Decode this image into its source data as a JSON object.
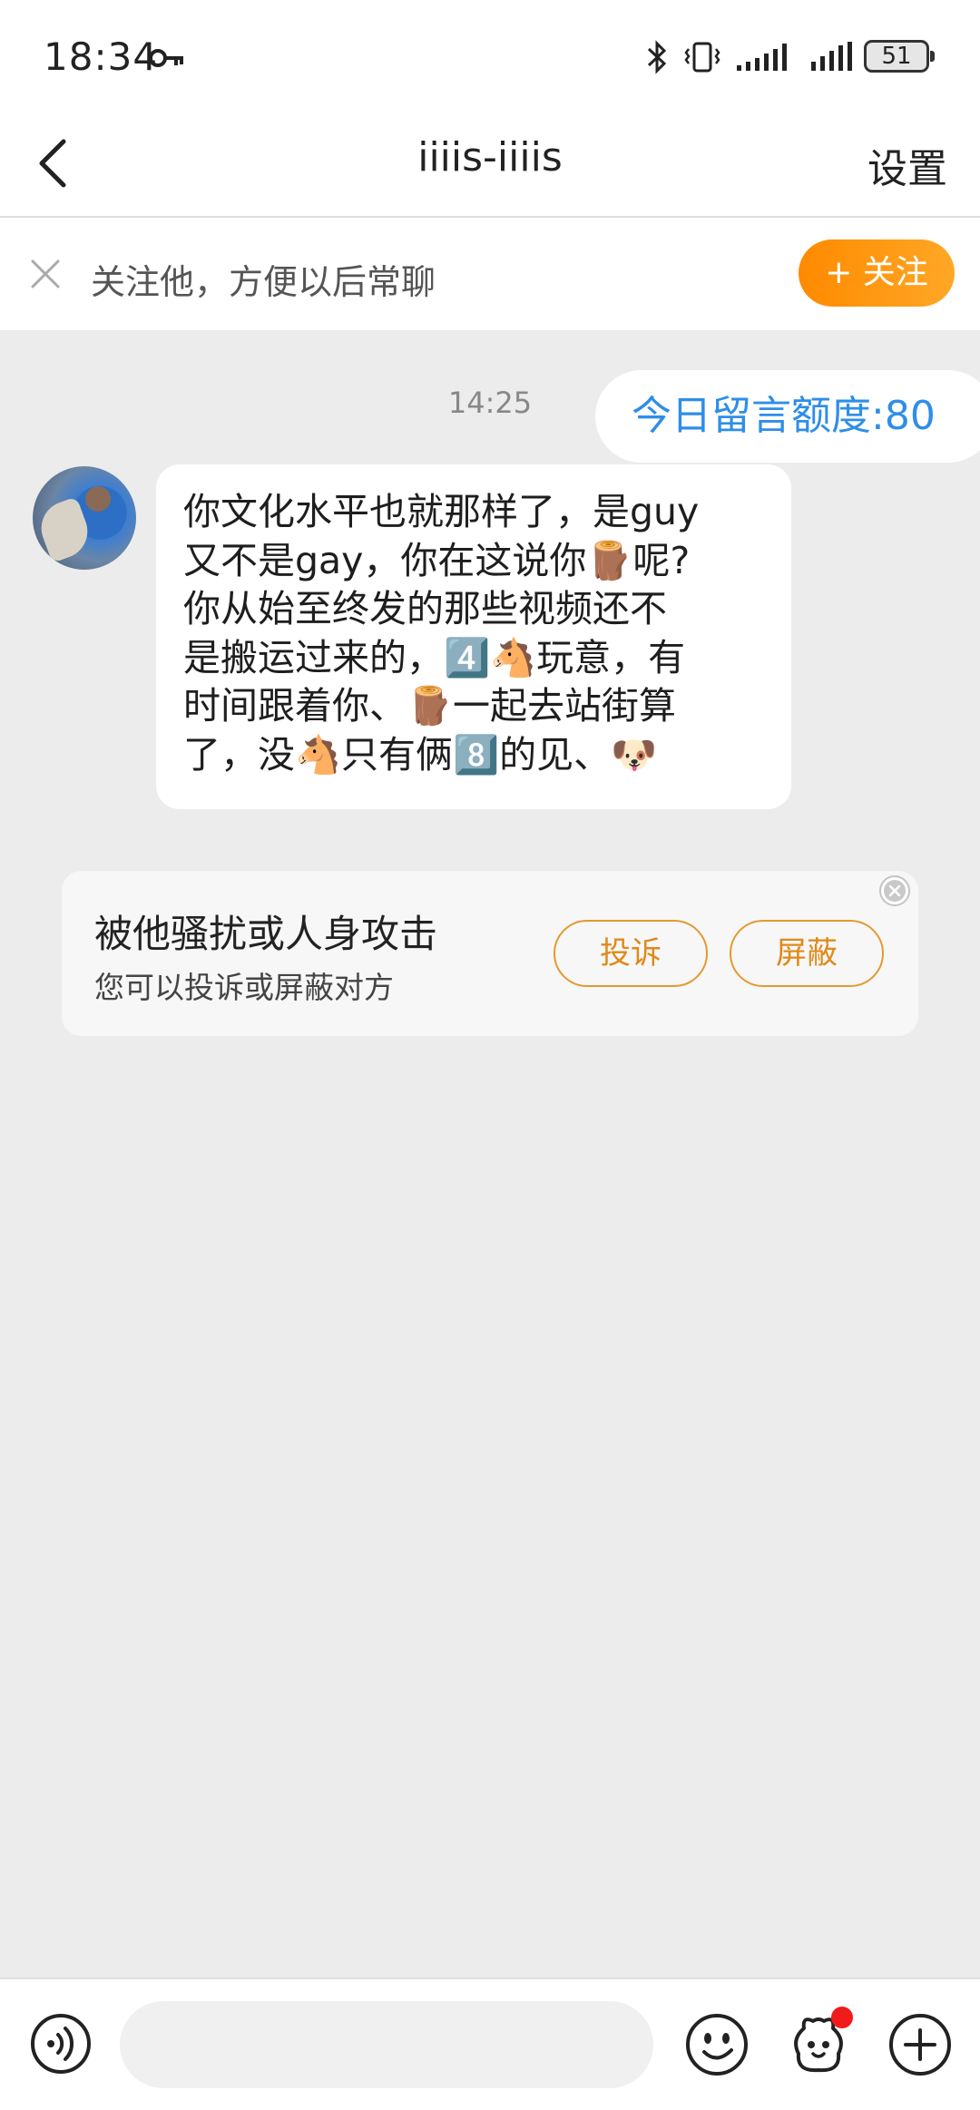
{
  "status_bar": {
    "time": "18:34",
    "battery": "51"
  },
  "nav": {
    "title": "iiiis-iiiis",
    "settings_label": "设置"
  },
  "follow_banner": {
    "text": "关注他，方便以后常聊",
    "button_label": "+ 关注"
  },
  "chat": {
    "timestamp": "14:25",
    "quota_message": "今日留言额度:80",
    "incoming_message_lines": [
      "你文化水平也就那样了，是guy",
      "又不是gay，你在这说你🪵呢?",
      "你从始至终发的那些视频还不",
      "是搬运过来的，4️⃣🐴玩意，有",
      "时间跟着你、🪵一起去站街算",
      "了，没🐴只有俩8️⃣的见、🐶"
    ]
  },
  "report_card": {
    "title": "被他骚扰或人身攻击",
    "subtitle": "您可以投诉或屏蔽对方",
    "complain_label": "投诉",
    "block_label": "屏蔽"
  },
  "input_bar": {
    "placeholder": ""
  },
  "icons": {
    "back": "back-arrow-icon",
    "dismiss": "close-icon",
    "voice": "voice-icon",
    "emoji": "emoji-icon",
    "sticker": "sticker-icon",
    "plus": "plus-icon",
    "key": "key-icon",
    "bluetooth": "bluetooth-icon",
    "vibrate": "vibrate-icon",
    "signal": "signal-icon",
    "battery": "battery-icon"
  },
  "colors": {
    "accent_orange": "#ff8a00",
    "link_blue": "#2e8ee8",
    "chat_background": "#ececec",
    "notification_red": "#f21b1b"
  }
}
